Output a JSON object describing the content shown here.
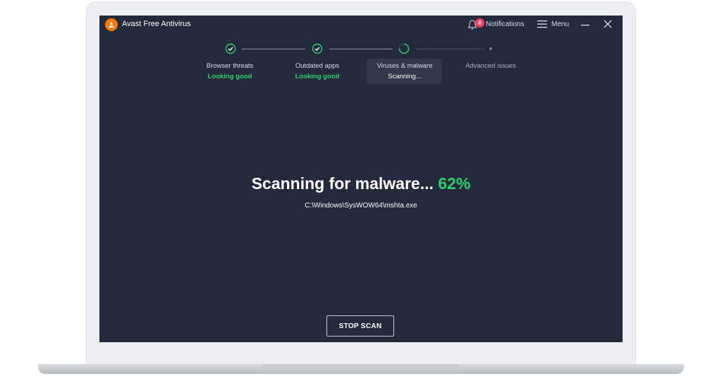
{
  "app": {
    "title": "Avast Free Antivirus",
    "brand_color": "#ff7800",
    "logo_icon": "avast-logo-icon"
  },
  "header": {
    "notifications_label": "Notifications",
    "notifications_count": "8",
    "menu_label": "Menu",
    "icons": [
      "bell-icon",
      "hamburger-menu-icon",
      "minimize-icon",
      "close-icon"
    ]
  },
  "steps": [
    {
      "label": "Browser threats",
      "status": "Looking good",
      "state": "done"
    },
    {
      "label": "Outdated apps",
      "status": "Looking good",
      "state": "done"
    },
    {
      "label": "Viruses & malware",
      "status": "Scanning...",
      "state": "active"
    },
    {
      "label": "Advanced issues",
      "status": "",
      "state": "pending"
    }
  ],
  "scan": {
    "headline": "Scanning for malware...",
    "percent": "62%",
    "progress": 0.62,
    "current_file": "C:\\Windows\\SysWOW64\\mshta.exe"
  },
  "actions": {
    "stop_label": "STOP SCAN"
  },
  "colors": {
    "background": "#232a3b",
    "success_green": "#2bd16a",
    "badge_red": "#ff3b5b"
  }
}
